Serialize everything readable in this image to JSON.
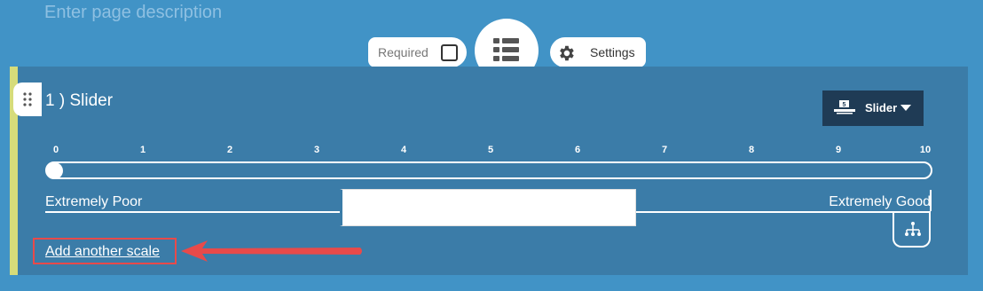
{
  "page": {
    "description_placeholder": "Enter page description"
  },
  "toolbar": {
    "required_label": "Required",
    "required_checked": false,
    "center_icon": "list-icon",
    "settings_label": "Settings",
    "settings_icon": "gear-icon"
  },
  "question": {
    "number": "1 )",
    "title": "Slider",
    "type_label": "Slider",
    "type_icon": "slider-type-icon",
    "accent_color": "#d6dc7a",
    "scale": {
      "ticks": [
        "0",
        "1",
        "2",
        "3",
        "4",
        "5",
        "6",
        "7",
        "8",
        "9",
        "10"
      ],
      "value": 0,
      "min": 0,
      "max": 10
    },
    "label_left": "Extremely Poor",
    "label_middle": "",
    "label_right": "Extremely Good",
    "logic_icon": "branch-logic-icon",
    "add_scale_link": "Add another scale"
  },
  "annotation": {
    "highlight_color": "#e84a4a",
    "arrow_icon": "arrow-left-icon"
  }
}
